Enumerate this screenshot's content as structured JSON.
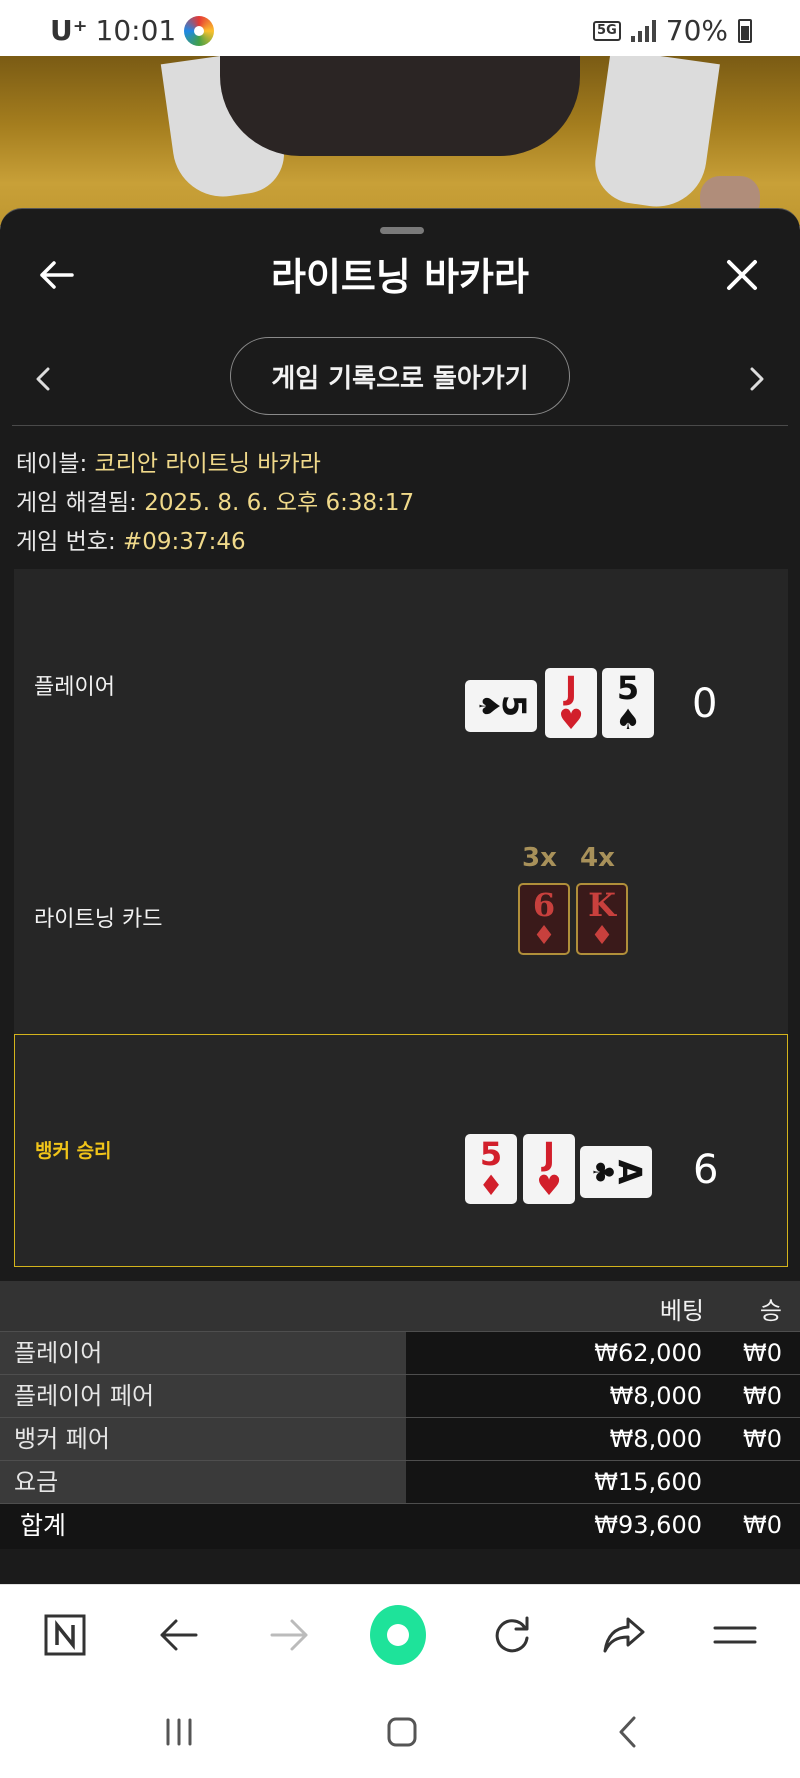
{
  "status_bar": {
    "carrier": "U⁺",
    "time": "10:01",
    "network": "5G",
    "battery": "70%"
  },
  "header": {
    "title": "라이트닝 바카라",
    "back_icon": "arrow-left-icon",
    "close_icon": "close-icon"
  },
  "nav": {
    "back_to_history": "게임 기록으로 돌아가기",
    "prev_icon": "chevron-left-icon",
    "next_icon": "chevron-right-icon"
  },
  "info": {
    "table_label": "테이블:",
    "table_value": "코리안 라이트닝 바카라",
    "resolved_label": "게임 해결됨:",
    "resolved_value": "2025. 8. 6. 오후 6:38:17",
    "game_no_label": "게임 번호:",
    "game_no_value": "#09:37:46"
  },
  "rounds": {
    "player": {
      "label": "플레이어",
      "score": "0",
      "cards": [
        {
          "rank": "5",
          "suit": "♠",
          "color": "black",
          "rotated": true
        },
        {
          "rank": "J",
          "suit": "♥",
          "color": "red",
          "rotated": false
        },
        {
          "rank": "5",
          "suit": "♠",
          "color": "black",
          "rotated": false
        }
      ]
    },
    "lightning": {
      "label": "라이트닝 카드",
      "cards": [
        {
          "rank": "6",
          "suit": "♦",
          "multiplier": "3x"
        },
        {
          "rank": "K",
          "suit": "♦",
          "multiplier": "4x"
        }
      ]
    },
    "banker": {
      "label": "뱅커 승리",
      "score": "6",
      "cards": [
        {
          "rank": "5",
          "suit": "♦",
          "color": "red",
          "rotated": false
        },
        {
          "rank": "J",
          "suit": "♥",
          "color": "red",
          "rotated": false
        },
        {
          "rank": "A",
          "suit": "♣",
          "color": "black",
          "rotated": true
        }
      ]
    }
  },
  "bets_table": {
    "headers": [
      "베팅",
      "승"
    ],
    "rows": [
      {
        "name": "플레이어",
        "bet": "₩62,000",
        "win": "₩0"
      },
      {
        "name": "플레이어 페어",
        "bet": "₩8,000",
        "win": "₩0"
      },
      {
        "name": "뱅커 페어",
        "bet": "₩8,000",
        "win": "₩0"
      },
      {
        "name": "요금",
        "bet": "₩15,600",
        "win": ""
      }
    ],
    "total": {
      "name": "합계",
      "bet": "₩93,600",
      "win": "₩0"
    }
  },
  "browser_bar": {
    "icons": [
      "naver-n-icon",
      "back-arrow-icon",
      "forward-arrow-icon",
      "home-icon",
      "reload-icon",
      "share-icon",
      "menu-icon"
    ],
    "colors": {
      "home": "#1ee39a"
    }
  },
  "system_nav": {
    "icons": [
      "recent-apps-icon",
      "home-square-icon",
      "back-chevron-icon"
    ]
  },
  "colors": {
    "sheet_bg": "#1b1b1b",
    "banker_border": "#d4b41c",
    "info_value": "#f0d98a",
    "card_red": "#d21f2b"
  }
}
